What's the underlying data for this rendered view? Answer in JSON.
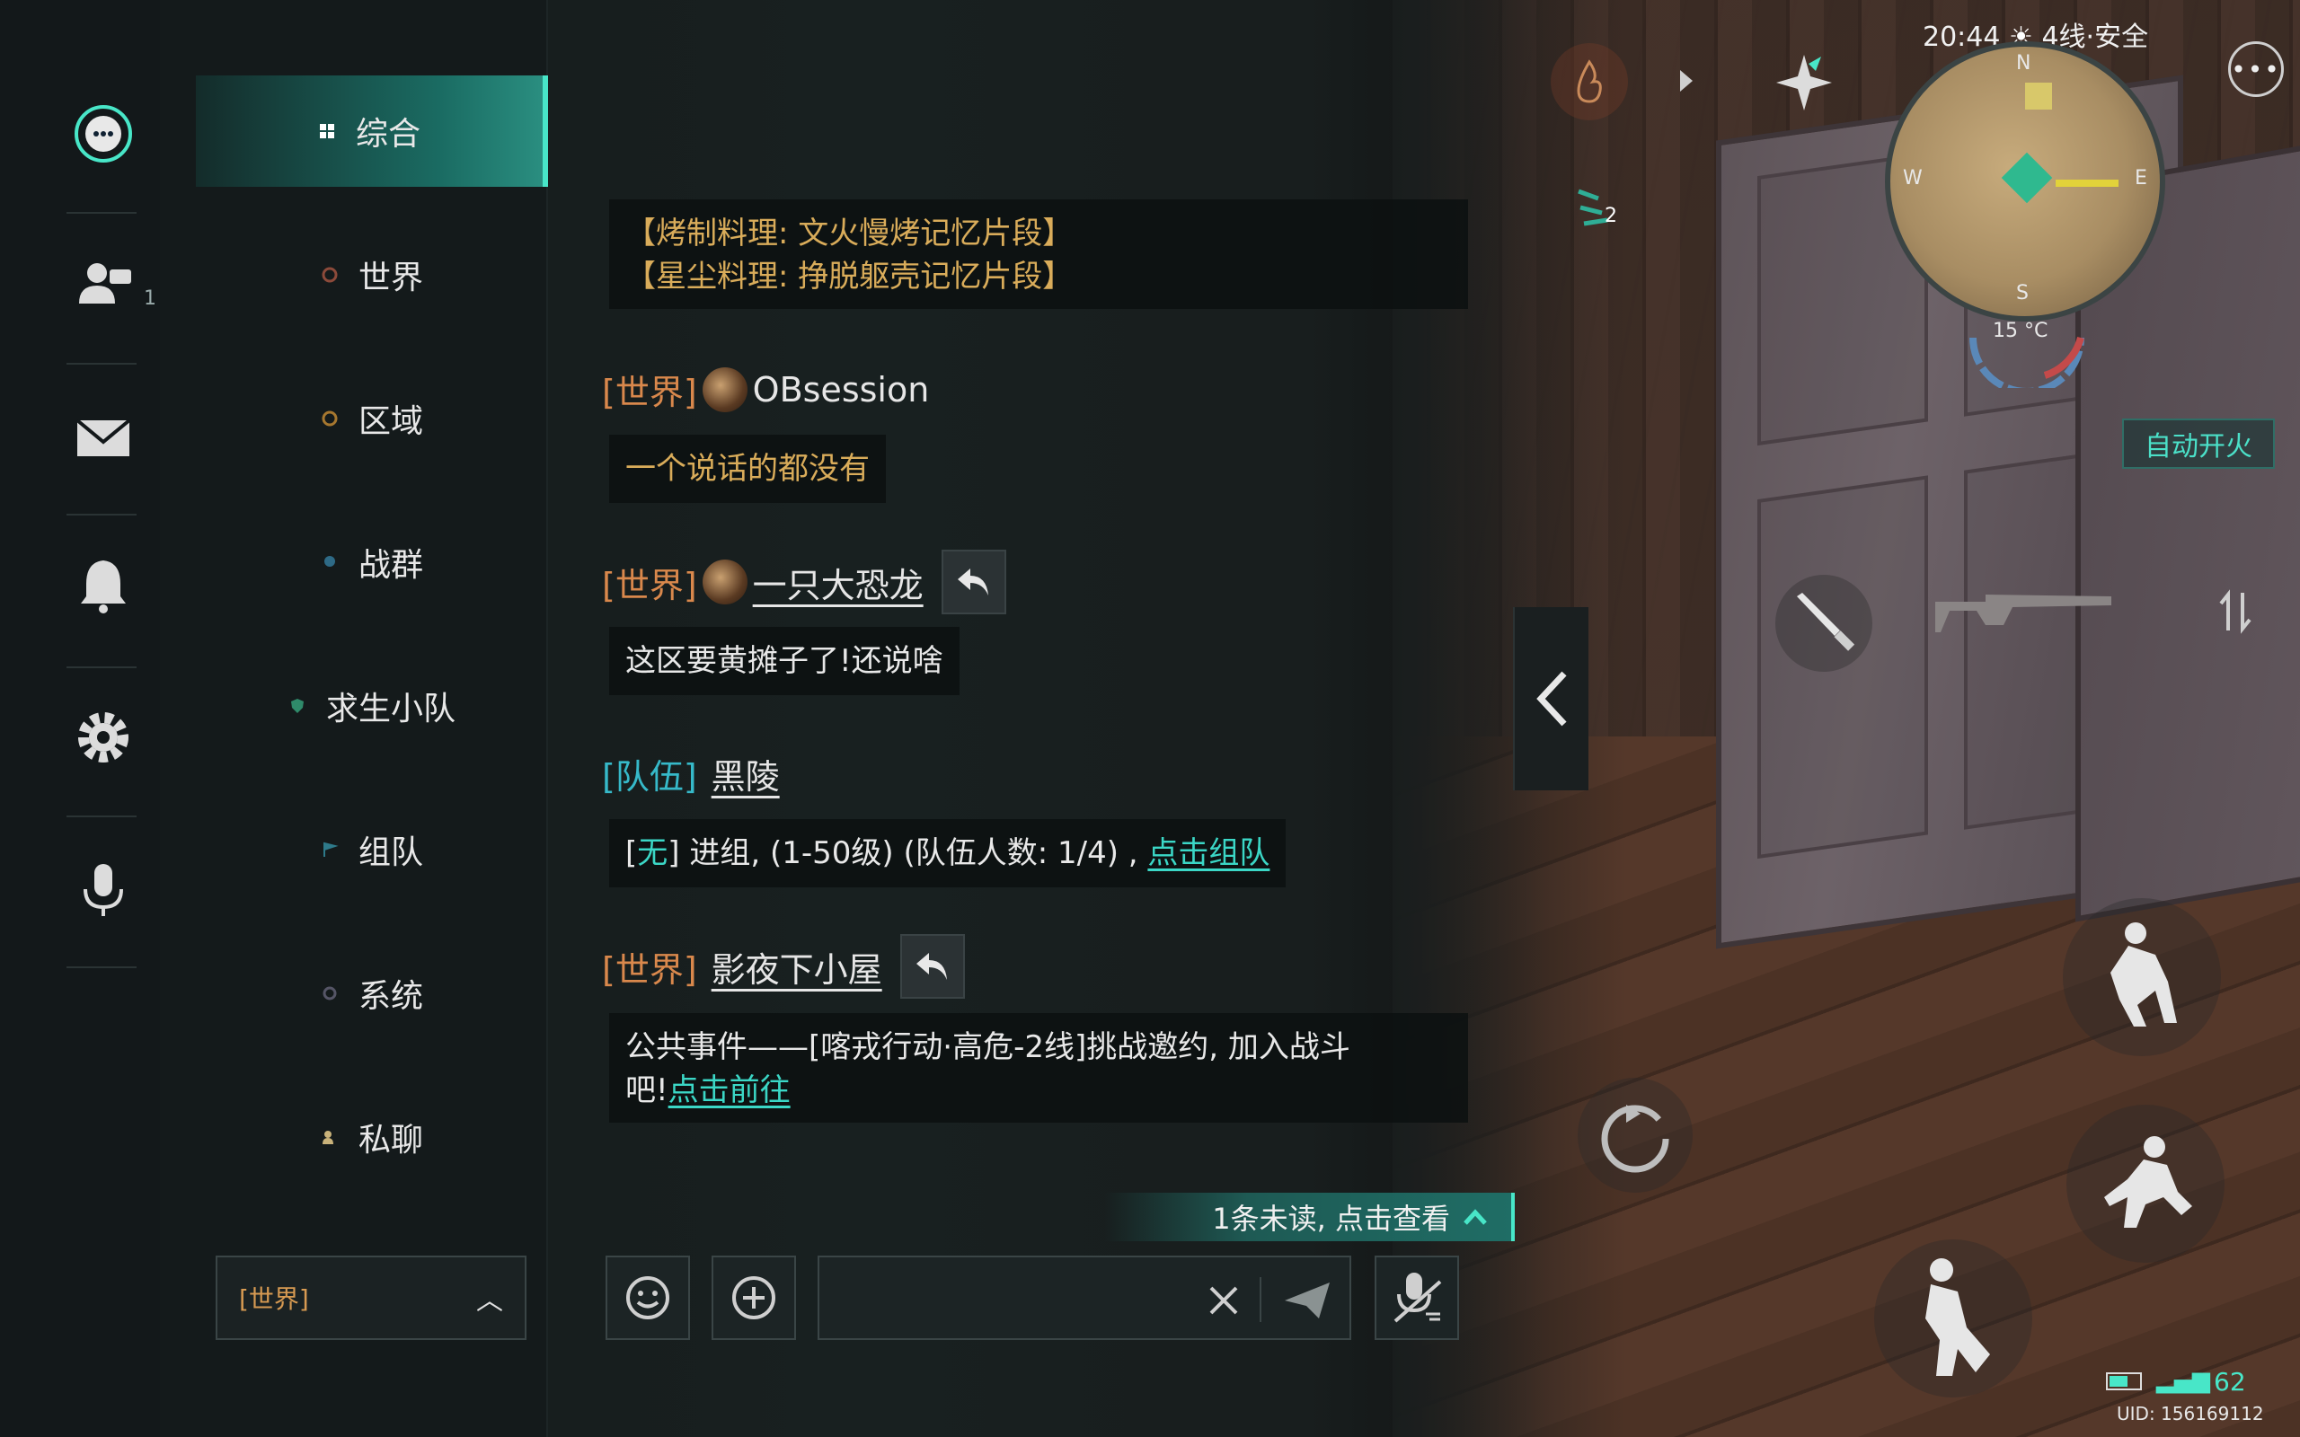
{
  "sidebar_icons": [
    {
      "name": "chat-icon",
      "active": true
    },
    {
      "name": "friends-icon",
      "badge": "1"
    },
    {
      "name": "mail-icon"
    },
    {
      "name": "bell-icon"
    },
    {
      "name": "gear-icon"
    },
    {
      "name": "microphone-icon"
    }
  ],
  "channels": [
    {
      "label": "综合",
      "active": true
    },
    {
      "label": "世界"
    },
    {
      "label": "区域"
    },
    {
      "label": "战群"
    },
    {
      "label": "求生小队"
    },
    {
      "label": "组队"
    },
    {
      "label": "系统"
    },
    {
      "label": "私聊"
    }
  ],
  "channel_select": {
    "value": "[世界]"
  },
  "messages": {
    "m0": {
      "line1": "【烤制料理: 文火慢烤记忆片段】",
      "line2": "【星尘料理: 挣脱躯壳记忆片段】"
    },
    "m1": {
      "tag": "[世界]",
      "name": "OBsession",
      "text": "一个说话的都没有"
    },
    "m2": {
      "tag": "[世界]",
      "name": "一只大恐龙",
      "text": "这区要黄摊子了!还说啥"
    },
    "m3": {
      "tag": "[队伍]",
      "name": "黑陵",
      "prefix_open": "[",
      "prefix": "无",
      "prefix_close": "]",
      "text": " 进组, (1-50级) (队伍人数: 1/4) , ",
      "link": "点击组队"
    },
    "m4": {
      "tag": "[世界]",
      "name": "影夜下小屋",
      "text1": "公共事件——[喀戎行动·高危-2线]挑战邀约, 加入战斗",
      "text2": "吧!",
      "link": "点击前往"
    }
  },
  "unread_notice": "1条未读, 点击查看",
  "input": {
    "placeholder": ""
  },
  "hud": {
    "time": "20:44",
    "line_status": "4线·安全",
    "compass": {
      "n": "N",
      "w": "W",
      "e": "E",
      "s": "S"
    },
    "temperature": "15 °C",
    "auto_fire": "自动开火",
    "quest_count": "2",
    "ping": "62",
    "uid": "UID: 156169112"
  },
  "colors": {
    "accent": "#48e6c8",
    "world_tag": "#d9884c",
    "team_tag": "#36b9c9",
    "gold_text": "#d9ac5a"
  }
}
